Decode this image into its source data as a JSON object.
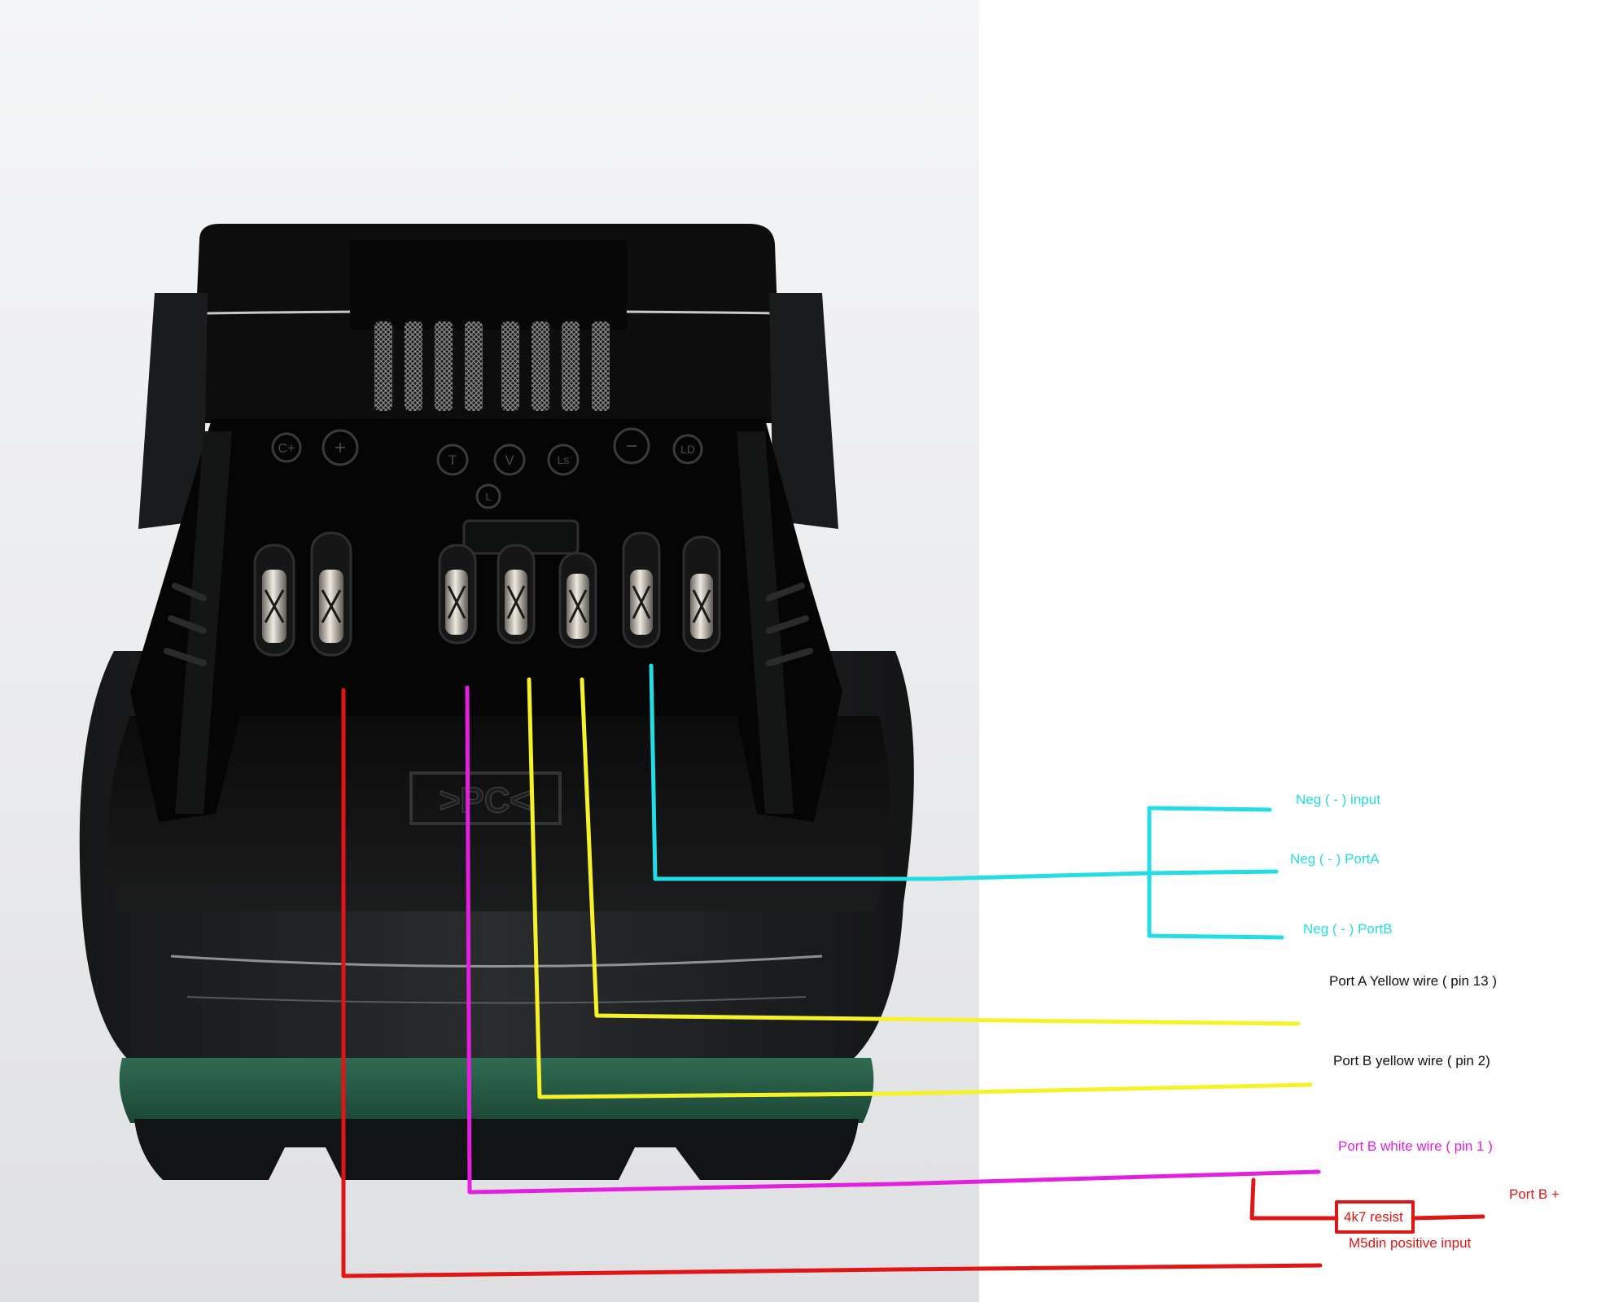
{
  "photo": {
    "subject": "battery-pack-terminal-photo",
    "terminal_markings": [
      "C+",
      "+",
      "T",
      "V",
      "Ls",
      "L",
      "−",
      "LD"
    ],
    "embossed_logo": ">PC<"
  },
  "colors": {
    "background": "#ffffff",
    "photo_background": "#e6e7e9",
    "cyan": "#22dde6",
    "yellow": "#f5f22a",
    "magenta": "#e51fe0",
    "red": "#e01515",
    "text_black": "#111111"
  },
  "labels": {
    "neg_input": "Neg ( - ) input",
    "neg_port_a": "Neg ( - ) PortA",
    "neg_port_b": "Neg ( - ) PortB",
    "port_a_yellow": "Port A Yellow wire ( pin 13 )",
    "port_b_yellow": "Port B yellow wire ( pin 2)",
    "port_b_white": "Port B white wire ( pin 1 )",
    "resistor": "4k7 resist",
    "port_b_plus": "Port B +",
    "m5din_positive": "M5din positive input"
  }
}
